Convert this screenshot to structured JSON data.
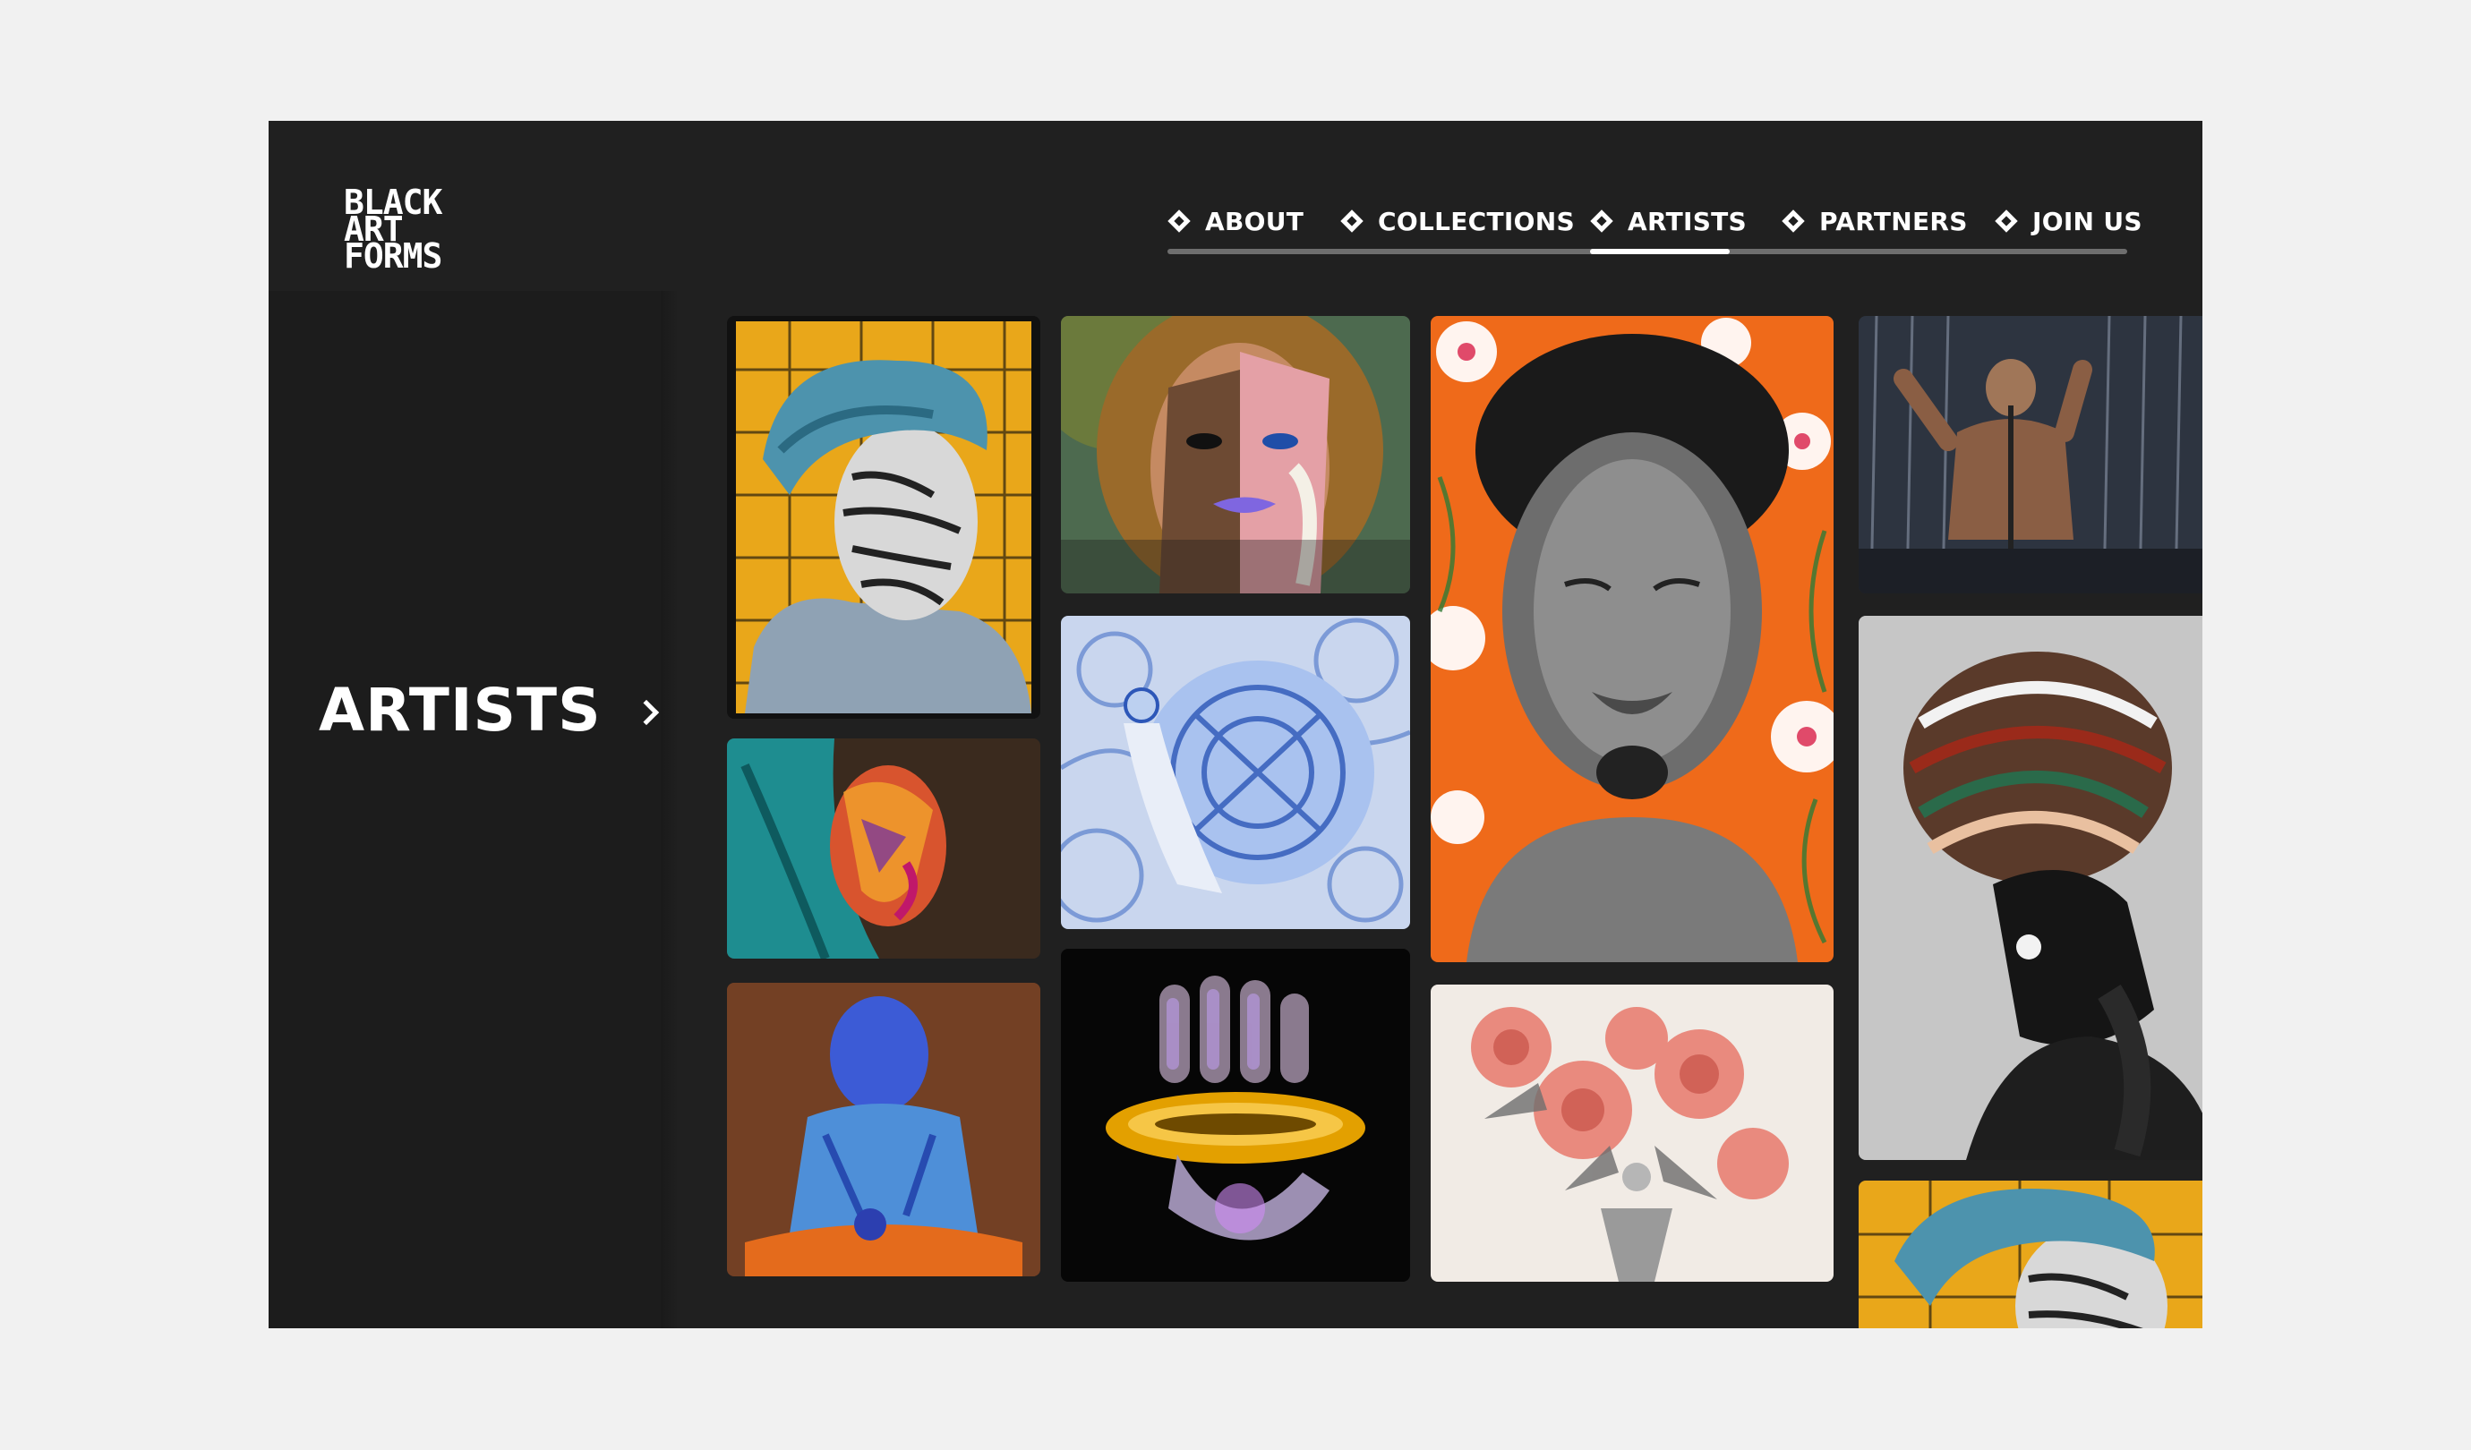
{
  "logo": {
    "line1": "BLACK",
    "line2": "ART",
    "line3": "FORMS"
  },
  "nav": {
    "items": [
      {
        "label": "ABOUT"
      },
      {
        "label": "COLLECTIONS"
      },
      {
        "label": "ARTISTS"
      },
      {
        "label": "PARTNERS"
      },
      {
        "label": "JOIN US"
      }
    ],
    "active": "ARTISTS"
  },
  "section": {
    "title": "ARTISTS"
  },
  "gallery": {
    "artworks": [
      {
        "subject": "portrait with blue turban on yellow pattern"
      },
      {
        "subject": "abstract face with pink and blue paint"
      },
      {
        "subject": "charcoal portrait with orange floral background"
      },
      {
        "subject": "performer in rain"
      },
      {
        "subject": "portrait with teal headscarf"
      },
      {
        "subject": "figure on blue floral pattern"
      },
      {
        "subject": "woman with patterned head wrap"
      },
      {
        "subject": "blue seated figure"
      },
      {
        "subject": "chrome hand with gold ring"
      },
      {
        "subject": "pink flower bouquet"
      },
      {
        "subject": "portrait with blue turban on yellow pattern (repeat)"
      }
    ]
  },
  "colors": {
    "frame": "#202020",
    "page": "#f1f1f1",
    "nav_track": "#6e6e6e"
  }
}
